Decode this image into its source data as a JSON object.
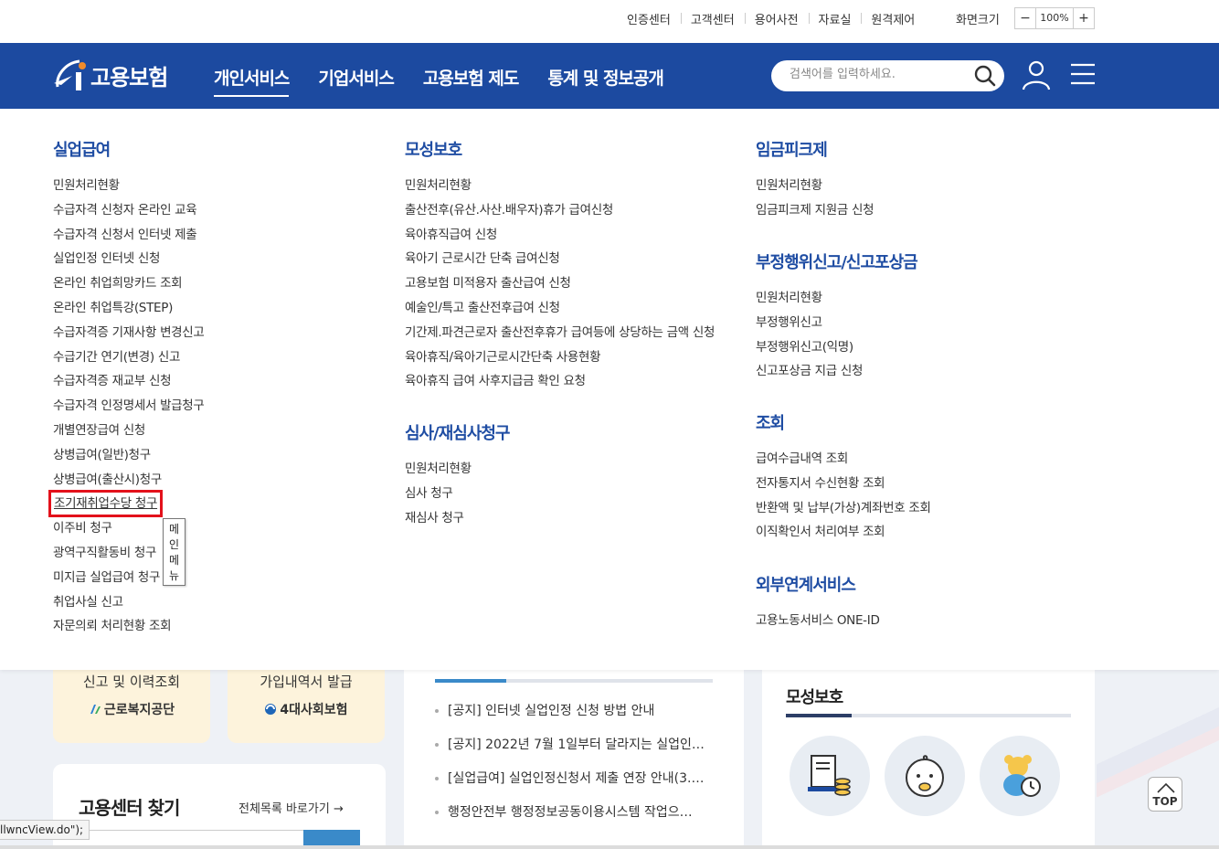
{
  "utility": {
    "links": [
      "인증센터",
      "고객센터",
      "용어사전",
      "자료실",
      "원격제어"
    ],
    "font_size_label": "화면크기",
    "zoom_minus": "−",
    "zoom_value": "100%",
    "zoom_plus": "+"
  },
  "header": {
    "logo_text": "고용보험",
    "nav": [
      {
        "label": "개인서비스",
        "active": true
      },
      {
        "label": "기업서비스",
        "active": false
      },
      {
        "label": "고용보험 제도",
        "active": false
      },
      {
        "label": "통계 및 정보공개",
        "active": false
      }
    ],
    "search_placeholder": "검색어를 입력하세요.",
    "brand_color": "#1c4aa0"
  },
  "mega_menu": {
    "col1": {
      "title": "실업급여",
      "items": [
        "민원처리현황",
        "수급자격 신청자 온라인 교육",
        "수급자격 신청서 인터넷 제출",
        "실업인정 인터넷 신청",
        "온라인 취업희망카드 조회",
        "온라인 취업특강(STEP)",
        "수급자격증 기재사항 변경신고",
        "수급기간 연기(변경) 신고",
        "수급자격증 재교부 신청",
        "수급자격 인정명세서 발급청구",
        "개별연장급여 신청",
        "상병급여(일반)청구",
        "상병급여(출산시)청구",
        "조기재취업수당 청구",
        "이주비 청구",
        "광역구직활동비 청구",
        "미지급 실업급여 청구",
        "취업사실 신고",
        "자문의뢰 처리현황 조회"
      ],
      "highlighted_index": 13,
      "tooltip": "메인메뉴"
    },
    "col2": [
      {
        "title": "모성보호",
        "items": [
          "민원처리현황",
          "출산전후(유산.사산.배우자)휴가 급여신청",
          "육아휴직급여 신청",
          "육아기 근로시간 단축 급여신청",
          "고용보험 미적용자 출산급여 신청",
          "예술인/특고 출산전후급여 신청",
          "기간제.파견근로자 출산전후휴가 급여등에 상당하는 금액 신청",
          "육아휴직/육아기근로시간단축 사용현황",
          "육아휴직 급여 사후지급금 확인 요청"
        ]
      },
      {
        "title": "심사/재심사청구",
        "items": [
          "민원처리현황",
          "심사 청구",
          "재심사 청구"
        ]
      }
    ],
    "col3": [
      {
        "title": "임금피크제",
        "items": [
          "민원처리현황",
          "임금피크제 지원금 신청"
        ]
      },
      {
        "title": "부정행위신고/신고포상금",
        "items": [
          "민원처리현황",
          "부정행위신고",
          "부정행위신고(익명)",
          "신고포상금 지급 신청"
        ]
      },
      {
        "title": "조회",
        "items": [
          "급여수급내역 조회",
          "전자통지서 수신현황 조회",
          "반환액 및 납부(가상)계좌번호 조회",
          "이직확인서 처리여부 조회"
        ]
      },
      {
        "title": "외부연계서비스",
        "items": [
          "고용노동서비스 ONE-ID"
        ]
      }
    ]
  },
  "background": {
    "card_a": {
      "top": "신고 및 이력조회",
      "brand": "근로복지공단"
    },
    "card_b": {
      "top": "가입내역서 발급",
      "brand": "4대사회보험"
    },
    "center_finder": {
      "title": "고용센터 찾기",
      "more": "전체목록 바로가기"
    },
    "notices": [
      "[공지] 인터넷 실업인정 신청 방법 안내",
      "[공지] 2022년 7월 1일부터 달라지는 실업인…",
      "[실업급여] 실업인정신청서 제출 연장 안내(3.…",
      "행정안전부 행정정보공동이용시스템 작업으…"
    ],
    "maternity": {
      "title": "모성보호"
    },
    "top_button": "TOP"
  },
  "status_bar": "llwncView.do\");"
}
